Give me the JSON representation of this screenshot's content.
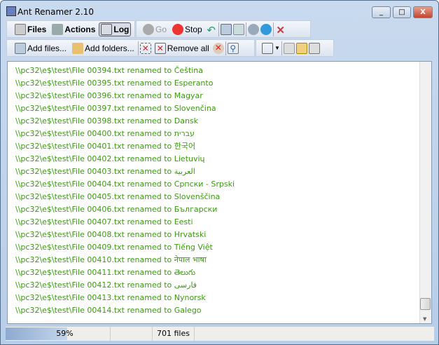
{
  "window": {
    "title": "Ant Renamer 2.10",
    "minimize": "_",
    "maximize": "□",
    "close": "X"
  },
  "toolbar1": {
    "files": "Files",
    "actions": "Actions",
    "log": "Log",
    "go": "Go",
    "stop": "Stop"
  },
  "toolbar2": {
    "add_files": "Add files...",
    "add_folders": "Add folders...",
    "remove_all": "Remove all"
  },
  "log": {
    "color": "#3a9a10",
    "entries": [
      "\\\\pc32\\e$\\test\\File 00394.txt renamed to Čeština",
      "\\\\pc32\\e$\\test\\File 00395.txt renamed to Esperanto",
      "\\\\pc32\\e$\\test\\File 00396.txt renamed to Magyar",
      "\\\\pc32\\e$\\test\\File 00397.txt renamed to Slovenčina",
      "\\\\pc32\\e$\\test\\File 00398.txt renamed to Dansk",
      "\\\\pc32\\e$\\test\\File 00400.txt renamed to עברית",
      "\\\\pc32\\e$\\test\\File 00401.txt renamed to 한국어",
      "\\\\pc32\\e$\\test\\File 00402.txt renamed to Lietuvių",
      "\\\\pc32\\e$\\test\\File 00403.txt renamed to العربية",
      "\\\\pc32\\e$\\test\\File 00404.txt renamed to Српски - Srpski",
      "\\\\pc32\\e$\\test\\File 00405.txt renamed to Slovenščina",
      "\\\\pc32\\e$\\test\\File 00406.txt renamed to Български",
      "\\\\pc32\\e$\\test\\File 00407.txt renamed to Eesti",
      "\\\\pc32\\e$\\test\\File 00408.txt renamed to Hrvatski",
      "\\\\pc32\\e$\\test\\File 00409.txt renamed to Tiếng Việt",
      "\\\\pc32\\e$\\test\\File 00410.txt renamed to नेपाल भाषा",
      "\\\\pc32\\e$\\test\\File 00411.txt renamed to తెలుగు",
      "\\\\pc32\\e$\\test\\File 00412.txt renamed to فارسی",
      "\\\\pc32\\e$\\test\\File 00413.txt renamed to Nynorsk",
      "\\\\pc32\\e$\\test\\File 00414.txt renamed to Galego"
    ]
  },
  "status": {
    "progress_percent": 59,
    "progress_label": "59%",
    "file_count": "701 files"
  }
}
